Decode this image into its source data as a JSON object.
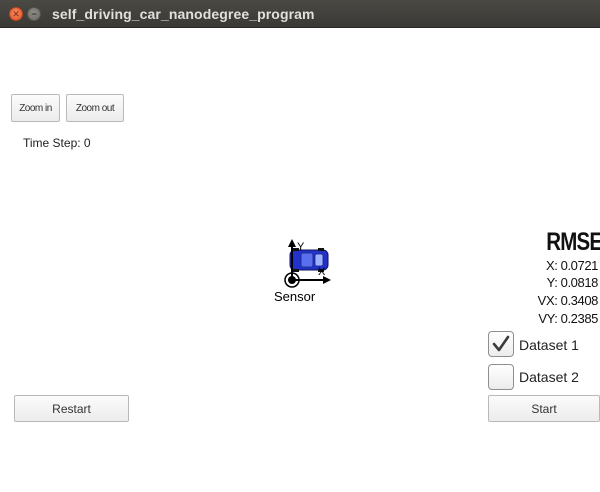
{
  "window": {
    "title": "self_driving_car_nanodegree_program"
  },
  "toolbar": {
    "zoom_in_label": "Zoom in",
    "zoom_out_label": "Zoom out"
  },
  "status": {
    "time_step": "Time Step: 0"
  },
  "scene": {
    "y_axis_label": "Y",
    "x_axis_label": "X",
    "sensor_label": "Sensor",
    "car_color": "#2233cc"
  },
  "rmse": {
    "title": "RMSE",
    "x": "X: 0.0721",
    "y": "Y: 0.0818",
    "vx": "VX: 0.3408",
    "vy": "VY: 0.2385"
  },
  "datasets": [
    {
      "label": "Dataset 1",
      "checked": true
    },
    {
      "label": "Dataset 2",
      "checked": false
    }
  ],
  "controls": {
    "restart_label": "Restart",
    "start_label": "Start"
  }
}
